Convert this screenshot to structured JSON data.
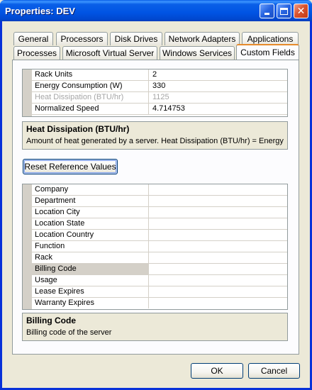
{
  "window": {
    "title": "Properties: DEV"
  },
  "tabs_back": [
    "General",
    "Processors",
    "Disk Drives",
    "Network Adapters",
    "Applications"
  ],
  "tabs_front": [
    "Processes",
    "Microsoft Virtual Server",
    "Windows Services",
    "Custom Fields"
  ],
  "active_tab": "Custom Fields",
  "grid1": {
    "rows": [
      {
        "name": "Rack Units",
        "value": "2"
      },
      {
        "name": "Energy Consumption (W)",
        "value": "330"
      },
      {
        "name": "Heat Dissipation (BTU/hr)",
        "value": "1125"
      },
      {
        "name": "Normalized Speed",
        "value": "4.714753"
      }
    ]
  },
  "desc1": {
    "title": "Heat Dissipation (BTU/hr)",
    "text": "Amount of heat generated by a server. Heat Dissipation (BTU/hr) = Energy..."
  },
  "reset_button": "Reset Reference Values",
  "grid2": {
    "rows": [
      {
        "name": "Company",
        "value": ""
      },
      {
        "name": "Department",
        "value": ""
      },
      {
        "name": "Location City",
        "value": ""
      },
      {
        "name": "Location State",
        "value": ""
      },
      {
        "name": "Location Country",
        "value": ""
      },
      {
        "name": "Function",
        "value": ""
      },
      {
        "name": "Rack",
        "value": ""
      },
      {
        "name": "Billing Code",
        "value": ""
      },
      {
        "name": "Usage",
        "value": ""
      },
      {
        "name": "Lease Expires",
        "value": ""
      },
      {
        "name": "Warranty Expires",
        "value": ""
      }
    ]
  },
  "desc2": {
    "title": "Billing Code",
    "text": "Billing code of the server"
  },
  "buttons": {
    "ok": "OK",
    "cancel": "Cancel"
  },
  "colors": {
    "titlebar": "#0054e3",
    "face": "#ece9d8",
    "active_tab_highlight": "#e68b2c"
  }
}
